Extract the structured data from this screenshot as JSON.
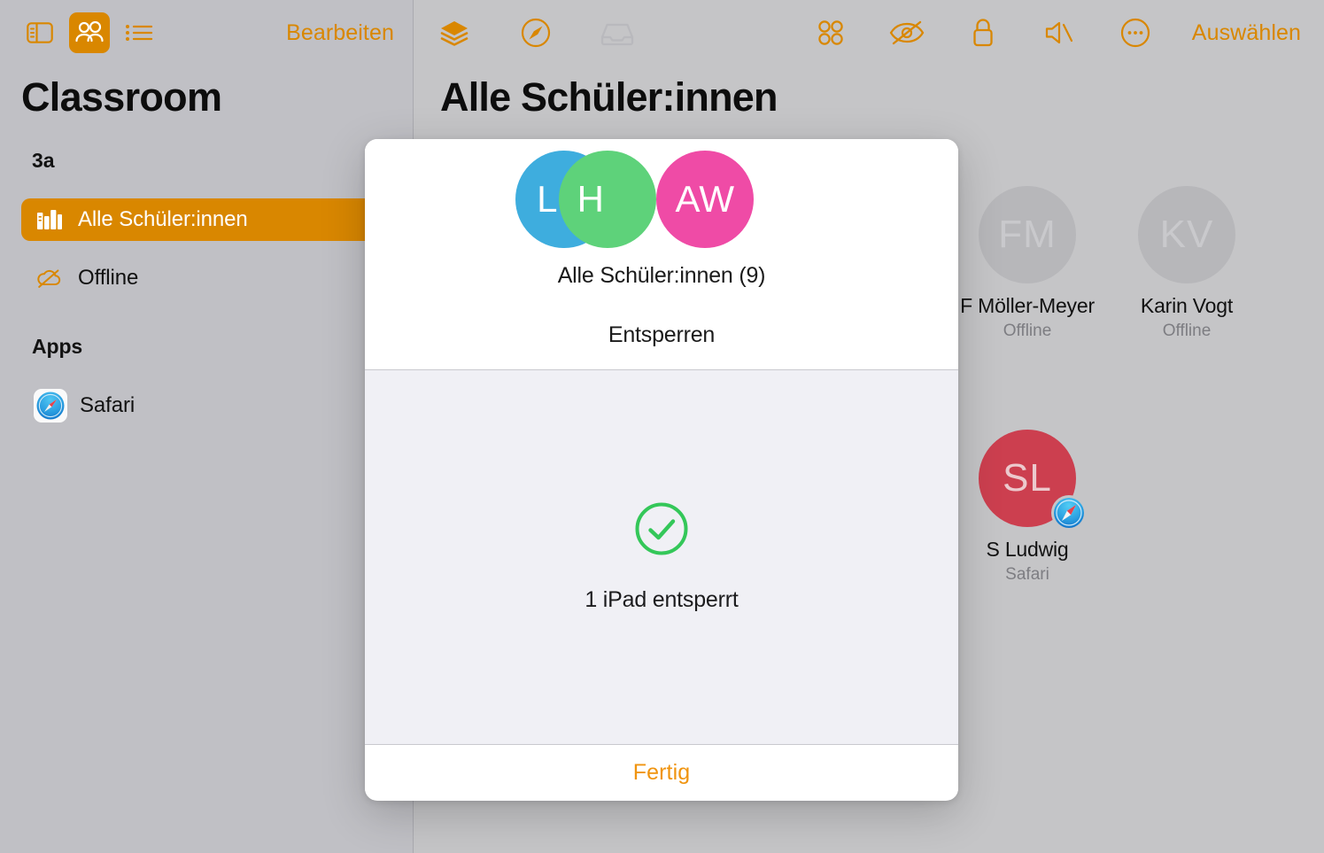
{
  "app": {
    "background_color": "#bfbfc4",
    "accent_color": "#d98700"
  },
  "sidebar": {
    "title": "Classroom",
    "toolbar": {
      "icons": [
        {
          "name": "sidebar-toggle-icon",
          "active": false
        },
        {
          "name": "people-icon",
          "active": true
        },
        {
          "name": "list-icon",
          "active": false
        }
      ],
      "edit_label": "Bearbeiten"
    },
    "sections": [
      {
        "header": "3a",
        "items": [
          {
            "label": "Alle Schüler:innen",
            "icon": "books-icon",
            "selected": true
          },
          {
            "label": "Offline",
            "icon": "cloud-slash-icon",
            "selected": false
          }
        ]
      },
      {
        "header": "Apps",
        "items": [
          {
            "label": "Safari",
            "icon": "safari-icon",
            "selected": false
          }
        ]
      }
    ]
  },
  "main": {
    "title": "Alle Schüler:innen",
    "toolbar": {
      "left_icons": [
        {
          "name": "layers-icon",
          "enabled": true
        },
        {
          "name": "navigate-safari-icon",
          "enabled": true
        },
        {
          "name": "inbox-tray-icon",
          "enabled": false
        }
      ],
      "right_icons": [
        {
          "name": "grid-apps-icon",
          "enabled": true
        },
        {
          "name": "eye-slash-icon",
          "enabled": true
        },
        {
          "name": "lock-icon",
          "enabled": true
        },
        {
          "name": "speaker-mute-icon",
          "enabled": true
        },
        {
          "name": "more-ellipsis-icon",
          "enabled": true
        }
      ],
      "select_label": "Auswählen"
    },
    "students": [
      {
        "initials": "FM",
        "name": "F Möller-Meyer",
        "status": "Offline",
        "color": "#b7b7ba",
        "offline": true,
        "app": null
      },
      {
        "initials": "KV",
        "name": "Karin Vogt",
        "status": "Offline",
        "color": "#b7b7ba",
        "offline": true,
        "app": null
      },
      {
        "initials": "SL",
        "name": "S Ludwig",
        "status": "Safari",
        "color": "#cc3f4f",
        "offline": false,
        "app": "safari-icon"
      }
    ]
  },
  "modal": {
    "avatar_stack": [
      {
        "initials": "L",
        "color": "#3eadde"
      },
      {
        "initials": "H",
        "color": "#5ed27a"
      },
      {
        "initials": "AW",
        "color": "#ef4ba6"
      }
    ],
    "group_name": "Alle Schüler:innen (9)",
    "action": "Entsperren",
    "result_icon": "check-circle-icon",
    "result_icon_color": "#34c759",
    "result_text": "1 iPad entsperrt",
    "done_label": "Fertig"
  }
}
